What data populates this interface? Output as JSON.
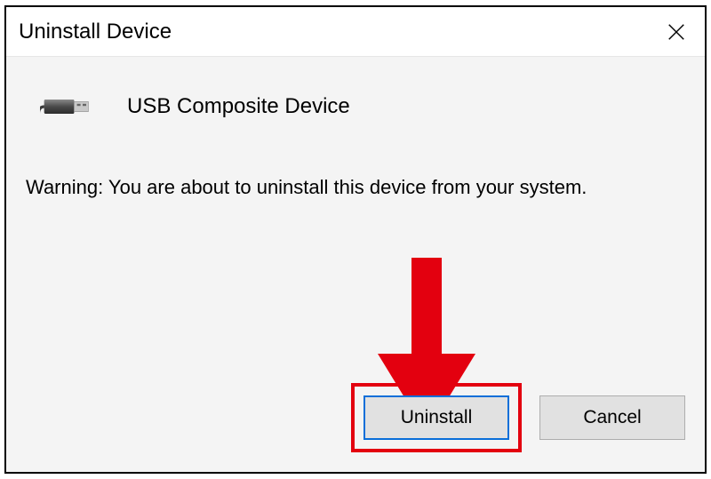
{
  "titlebar": {
    "title": "Uninstall Device"
  },
  "device": {
    "name": "USB Composite Device"
  },
  "warning": "Warning: You are about to uninstall this device from your system.",
  "buttons": {
    "uninstall": "Uninstall",
    "cancel": "Cancel"
  },
  "annotation": {
    "highlight_color": "#e3000f"
  }
}
